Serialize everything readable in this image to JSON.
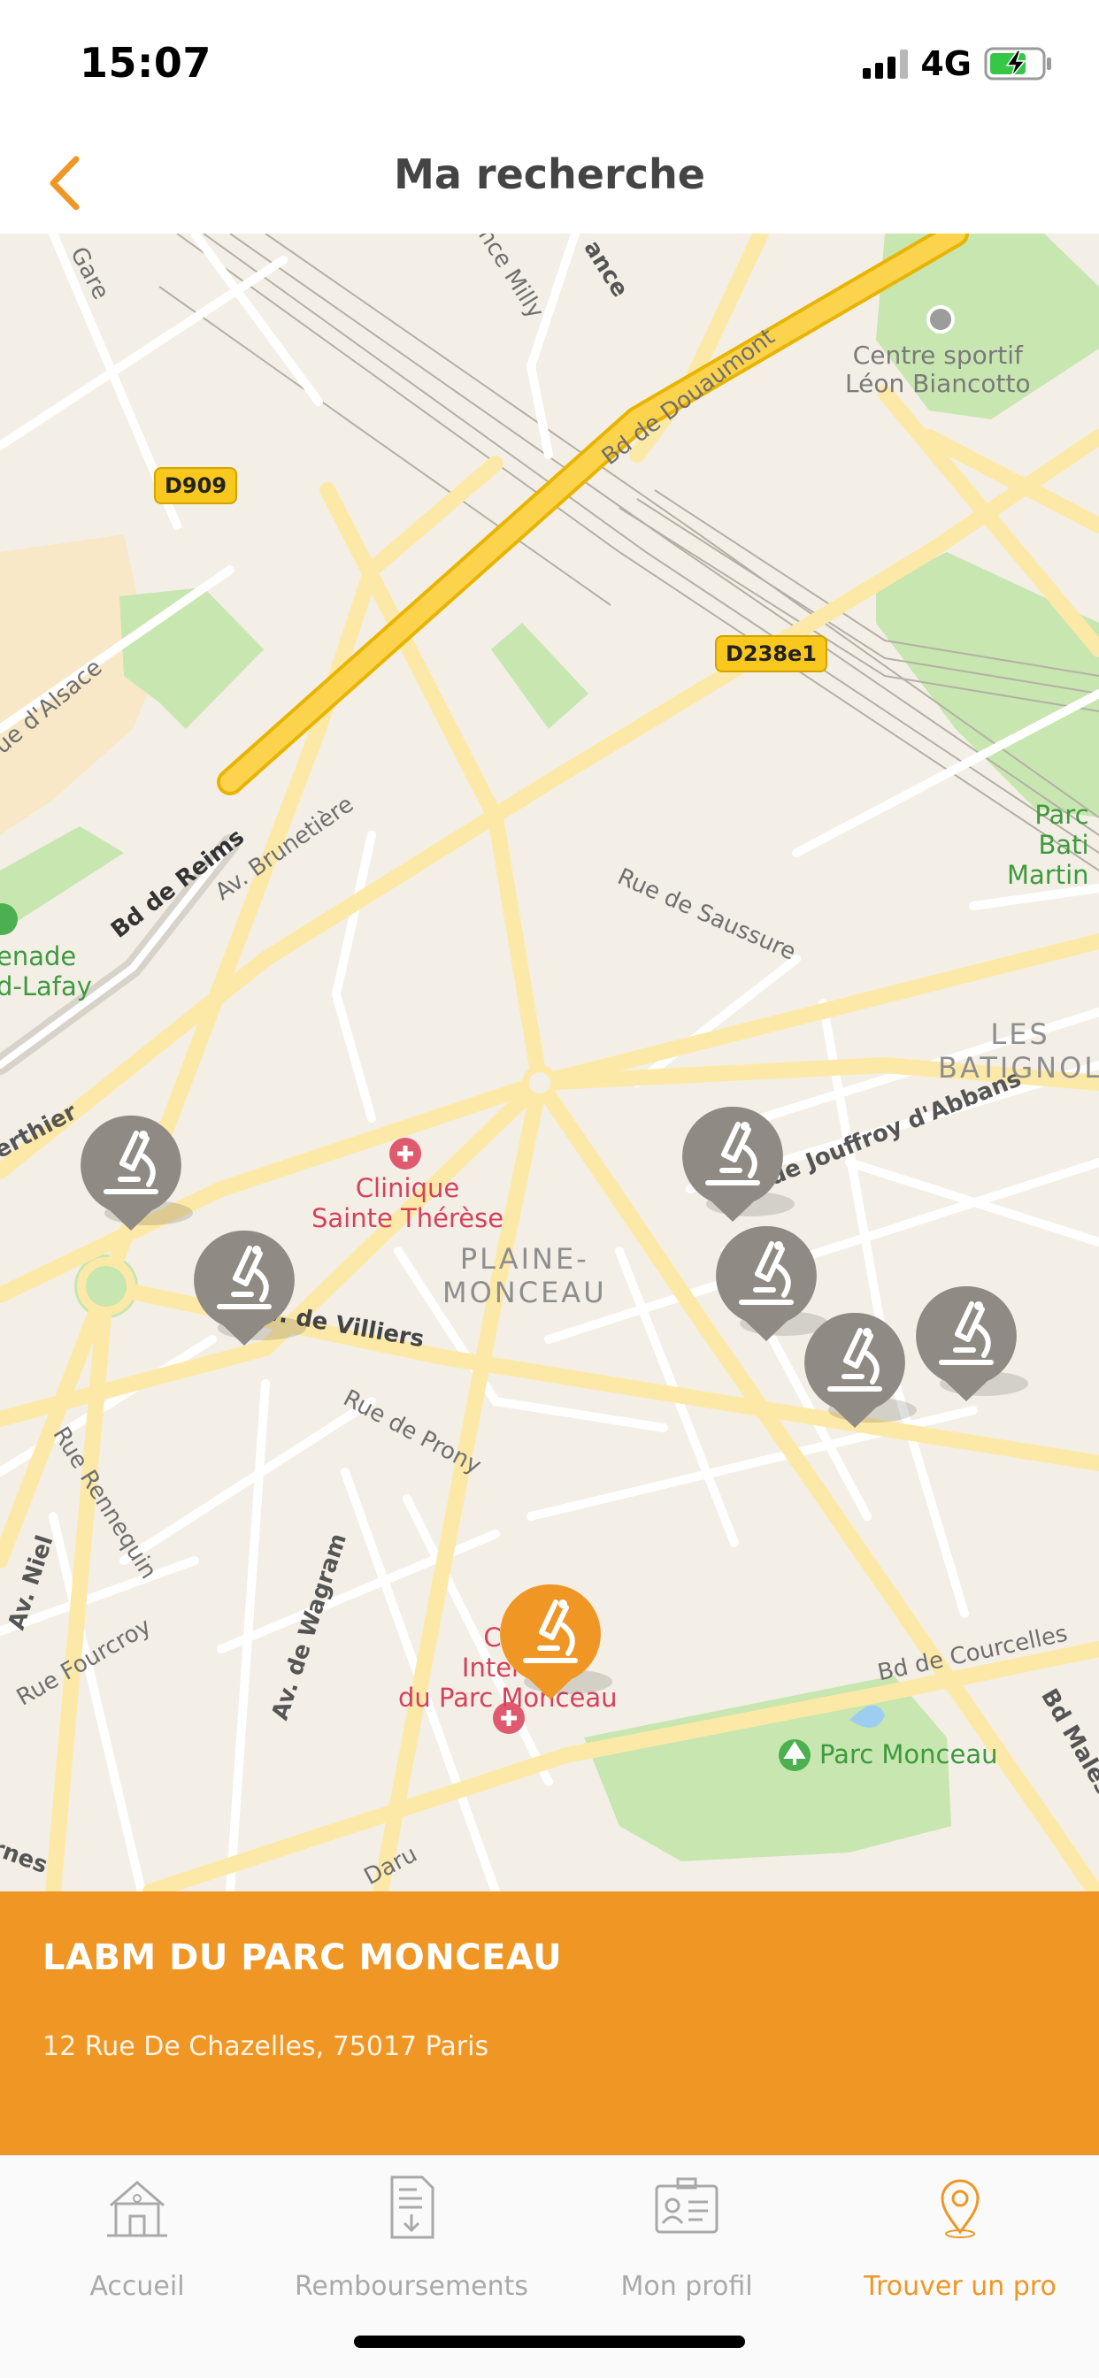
{
  "status_bar": {
    "time": "15:07",
    "network": "4G"
  },
  "header": {
    "title": "Ma recherche",
    "back_icon": "chevron-left-icon"
  },
  "map": {
    "streets": {
      "gare": "Gare",
      "milly": "nce Milly",
      "ance": "ance",
      "douaumont": "Bd de Douaumont",
      "alsace": "ue d'Alsace",
      "reims": "Bd de Reims",
      "brunetiere": "Av. Brunetière",
      "saussure": "Rue de Saussure",
      "jouffroy": "Rue Jouffroy d'Abbans",
      "berthier": "erthier",
      "villiers": "v. de Villiers",
      "prony": "Rue de Prony",
      "rennequin": "Rue Rennequin",
      "niel": "Av. Niel",
      "wagram": "Av. de Wagram",
      "fourcroy": "Rue Fourcroy",
      "courcelles": "Bd de Courcelles",
      "malesherbes": "Bd Males",
      "daru": "Daru",
      "ternes": "rnes"
    },
    "road_shields": {
      "d909": "D909",
      "d238": "D238e1"
    },
    "districts": {
      "plaine_monceau": "PLAINE-\nMONCEAU",
      "batignolles": "LES\nBATIGNOL"
    },
    "pois": {
      "centre_sportif": "Centre sportif\nLéon Biancotto",
      "clinique_ste_therese": "Clinique\nSainte Thérèse",
      "clinique_intl": "Clin\nInterna\ndu Parc Monceau",
      "parc_monceau": "Parc Monceau",
      "parc_batignolles": "Parc\nBati\nMartin",
      "promenade": "enade\nd-Lafay"
    },
    "pin_icon": "microscope-icon"
  },
  "selected_lab": {
    "name": "LABM DU PARC MONCEAU",
    "address": "12 Rue De Chazelles, 75017 Paris"
  },
  "tabs": [
    {
      "label": "Accueil",
      "icon": "house-icon",
      "active": false
    },
    {
      "label": "Remboursements",
      "icon": "document-download-icon",
      "active": false
    },
    {
      "label": "Mon profil",
      "icon": "id-card-icon",
      "active": false
    },
    {
      "label": "Trouver un pro",
      "icon": "location-pin-icon",
      "active": true
    }
  ],
  "colors": {
    "accent": "#f09624",
    "pin_inactive": "#8f8b84",
    "map_bg": "#f3efe6",
    "park": "#c7e6b0"
  }
}
